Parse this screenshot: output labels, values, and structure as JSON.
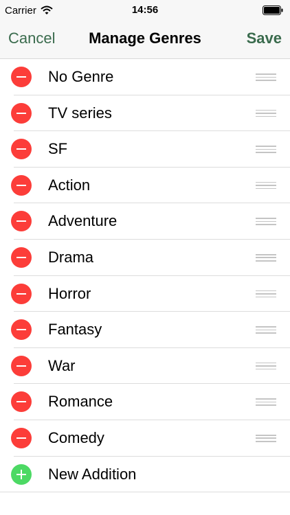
{
  "status_bar": {
    "carrier": "Carrier",
    "time": "14:56"
  },
  "nav": {
    "cancel_label": "Cancel",
    "title": "Manage Genres",
    "save_label": "Save"
  },
  "genres": [
    {
      "label": "No Genre"
    },
    {
      "label": "TV series"
    },
    {
      "label": "SF"
    },
    {
      "label": "Action"
    },
    {
      "label": "Adventure"
    },
    {
      "label": "Drama"
    },
    {
      "label": "Horror"
    },
    {
      "label": "Fantasy"
    },
    {
      "label": "War"
    },
    {
      "label": "Romance"
    },
    {
      "label": "Comedy"
    }
  ],
  "add_row": {
    "label": "New Addition"
  },
  "colors": {
    "accent": "#3a6b4d",
    "delete": "#fc3d39",
    "add": "#4cd964"
  },
  "icons": {
    "delete": "minus-circle-icon",
    "add": "plus-circle-icon",
    "reorder": "reorder-handle-icon",
    "wifi": "wifi-icon",
    "battery": "battery-icon"
  }
}
